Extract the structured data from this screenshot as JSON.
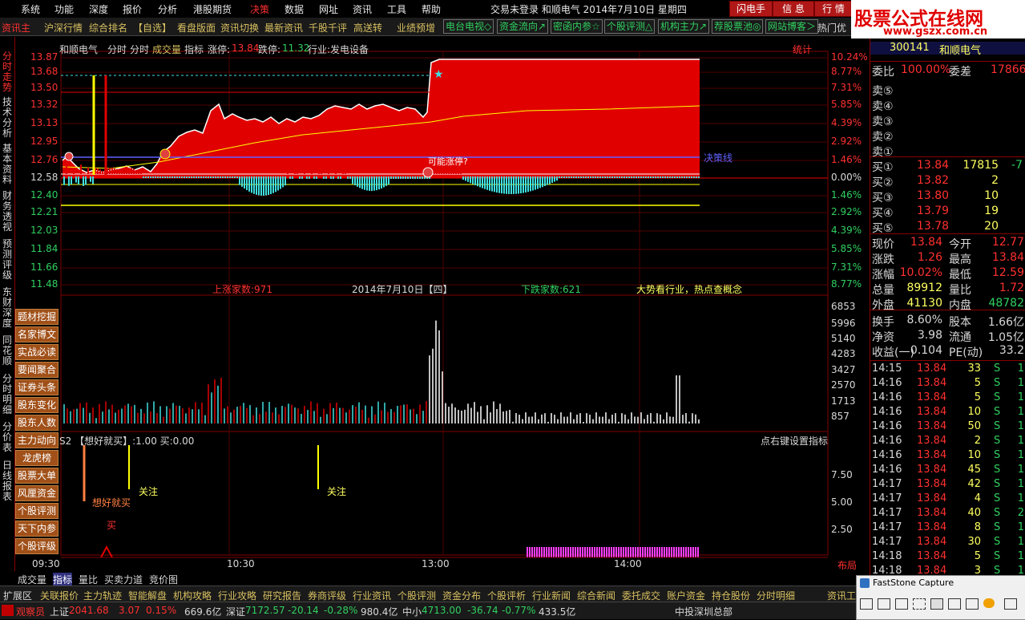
{
  "menu": [
    "系统",
    "功能",
    "深度",
    "报价",
    "分析",
    "港股期货",
    "决策",
    "数据",
    "网址",
    "资讯",
    "工具",
    "帮助"
  ],
  "title_info": "交易未登录  和顺电气  2014年7月10日  星期四",
  "top_buttons": [
    "闪电手",
    "信 息",
    "行 情"
  ],
  "logo": {
    "line1": "股票公式在线网",
    "line2": "www.gszx.com.cn"
  },
  "toolbar2": {
    "items": [
      "资讯主",
      "沪深行情",
      "综合排名",
      "【自选】",
      "看盘版面",
      "资讯切换",
      "最新资讯",
      "千股千评",
      "高送转",
      "业绩预增"
    ],
    "green_items": [
      "电台电视◇",
      "资金流向↗",
      "密函内参☆",
      "个股评测△",
      "机构主力↗",
      "荐股票池◎",
      "网站博客＞"
    ],
    "extra": "热门优"
  },
  "left_tabs": [
    "分时走势",
    "技术分析",
    "基本资料",
    "财务透视",
    "预测评级",
    "东财深度",
    "同花顺",
    "分时明细",
    "分价表",
    "日线报表"
  ],
  "mid_buttons": [
    "题材挖掘",
    "名家博文",
    "实战必读",
    "要闻聚合",
    "证券头条",
    "股东变化",
    "股东人数",
    "主力动向",
    "龙虎榜",
    "股票大单",
    "风厘资金",
    "个股评测",
    "天下内参",
    "个股评级"
  ],
  "chart_header": {
    "name": "和顺电气",
    "t1": "分时",
    "t2": "分时",
    "t3": "成交量",
    "t4": "指标",
    "limit_up_label": "涨停:",
    "limit_up": "13.84",
    "limit_down_label": "跌停:",
    "limit_down": "11.32",
    "industry": "行业:发电设备",
    "stats": "统计"
  },
  "price_axis": [
    "13.87",
    "13.68",
    "13.50",
    "13.32",
    "13.13",
    "12.95",
    "12.76",
    "12.58",
    "12.40",
    "12.21",
    "12.03",
    "11.84",
    "11.66",
    "11.48"
  ],
  "pct_axis": [
    "10.24%",
    "8.77%",
    "7.31%",
    "5.85%",
    "4.39%",
    "2.92%",
    "1.46%",
    "0.00%",
    "1.46%",
    "2.92%",
    "4.39%",
    "5.85%",
    "7.31%",
    "8.77%"
  ],
  "vol_axis": [
    "6853",
    "5996",
    "5140",
    "4283",
    "3427",
    "2570",
    "1713",
    "857"
  ],
  "ind_axis": [
    "7.50",
    "5.00",
    "2.50"
  ],
  "time_axis": [
    "09:30",
    "10:30",
    "13:00",
    "14:00"
  ],
  "annotations": {
    "decision_line": "决策线",
    "maybe_limit": "可能涨停?",
    "up_count": "上涨家数:971",
    "date_label": "2014年7月10日【四】",
    "down_count": "下跌家数:621",
    "trend_text": "大势看行业，热点查概念",
    "indicator_title": "S2 【想好就买】:1.00  买:0.00",
    "right_click": "点右键设置指标",
    "watch": "关注",
    "buy_signal": "想好就买",
    "buy": "买",
    "layout": "布局"
  },
  "right_panel": {
    "code": "300141",
    "name": "和顺电气",
    "weibi_label": "委比",
    "weibi": "100.00%",
    "weicha_label": "委差",
    "weicha": "17866",
    "sells": [
      {
        "label": "卖⑤"
      },
      {
        "label": "卖④"
      },
      {
        "label": "卖③"
      },
      {
        "label": "卖②"
      },
      {
        "label": "卖①"
      }
    ],
    "buys": [
      {
        "label": "买①",
        "price": "13.84",
        "vol": "17815",
        "chg": "-7"
      },
      {
        "label": "买②",
        "price": "13.82",
        "vol": "2",
        "chg": ""
      },
      {
        "label": "买③",
        "price": "13.80",
        "vol": "10",
        "chg": ""
      },
      {
        "label": "买④",
        "price": "13.79",
        "vol": "19",
        "chg": ""
      },
      {
        "label": "买⑤",
        "price": "13.78",
        "vol": "20",
        "chg": ""
      }
    ],
    "stats": [
      {
        "l1": "现价",
        "v1": "13.84",
        "l2": "今开",
        "v2": "12.77"
      },
      {
        "l1": "涨跌",
        "v1": "1.26",
        "l2": "最高",
        "v2": "13.84"
      },
      {
        "l1": "涨幅",
        "v1": "10.02%",
        "l2": "最低",
        "v2": "12.59"
      },
      {
        "l1": "总量",
        "v1": "89912",
        "l2": "量比",
        "v2": "1.72"
      },
      {
        "l1": "外盘",
        "v1": "41130",
        "l2": "内盘",
        "v2": "48782"
      },
      {
        "l1": "换手",
        "v1": "8.60%",
        "l2": "股本",
        "v2": "1.66亿"
      },
      {
        "l1": "净资",
        "v1": "3.98",
        "l2": "流通",
        "v2": "1.05亿"
      },
      {
        "l1": "收益(一)",
        "v1": "0.104",
        "l2": "PE(动)",
        "v2": "33.2"
      }
    ],
    "ticks": [
      {
        "t": "14:15",
        "p": "13.84",
        "v": "33",
        "s": "S",
        "n": "1"
      },
      {
        "t": "14:16",
        "p": "13.84",
        "v": "5",
        "s": "S",
        "n": "1"
      },
      {
        "t": "14:16",
        "p": "13.84",
        "v": "5",
        "s": "S",
        "n": "1"
      },
      {
        "t": "14:16",
        "p": "13.84",
        "v": "10",
        "s": "S",
        "n": "1"
      },
      {
        "t": "14:16",
        "p": "13.84",
        "v": "50",
        "s": "S",
        "n": "1"
      },
      {
        "t": "14:16",
        "p": "13.84",
        "v": "2",
        "s": "S",
        "n": "1"
      },
      {
        "t": "14:16",
        "p": "13.84",
        "v": "10",
        "s": "S",
        "n": "1"
      },
      {
        "t": "14:16",
        "p": "13.84",
        "v": "45",
        "s": "S",
        "n": "1"
      },
      {
        "t": "14:17",
        "p": "13.84",
        "v": "42",
        "s": "S",
        "n": "1"
      },
      {
        "t": "14:17",
        "p": "13.84",
        "v": "4",
        "s": "S",
        "n": "1"
      },
      {
        "t": "14:17",
        "p": "13.84",
        "v": "40",
        "s": "S",
        "n": "2"
      },
      {
        "t": "14:17",
        "p": "13.84",
        "v": "8",
        "s": "S",
        "n": "1"
      },
      {
        "t": "14:17",
        "p": "13.84",
        "v": "30",
        "s": "S",
        "n": "1"
      },
      {
        "t": "14:18",
        "p": "13.84",
        "v": "5",
        "s": "S",
        "n": "1"
      },
      {
        "t": "14:18",
        "p": "13.84",
        "v": "3",
        "s": "S",
        "n": "1"
      }
    ]
  },
  "bottom_tabs": [
    "成交量",
    "指标",
    "量比",
    "买卖力道",
    "竞价图"
  ],
  "link_bar": [
    "扩展区",
    "关联报价",
    "主力轨迹",
    "智能解盘",
    "机构攻略",
    "行业攻略",
    "研究报告",
    "券商评级",
    "行业资讯",
    "个股评测",
    "资金分布",
    "个股评析",
    "行业新闻",
    "综合新闻",
    "委托成交",
    "账户资金",
    "持仓股份",
    "分时明细",
    "资讯工"
  ],
  "status": {
    "observer": "观察员",
    "sh_label": "上证",
    "sh": "2041.68",
    "sh_chg": "3.07",
    "sh_pct": "0.15%",
    "sh_amt": "669.6亿",
    "sz_label": "深证",
    "sz": "7172.57",
    "sz_chg": "-20.14",
    "sz_pct": "-0.28%",
    "sz_amt": "980.4亿",
    "zx_label": "中小",
    "zx": "4713.00",
    "zx_chg": "-36.74",
    "zx_pct": "-0.77%",
    "zx_amt": "433.5亿",
    "broker": "中投深圳总部"
  },
  "fastcapture": "FastStone Capture"
}
